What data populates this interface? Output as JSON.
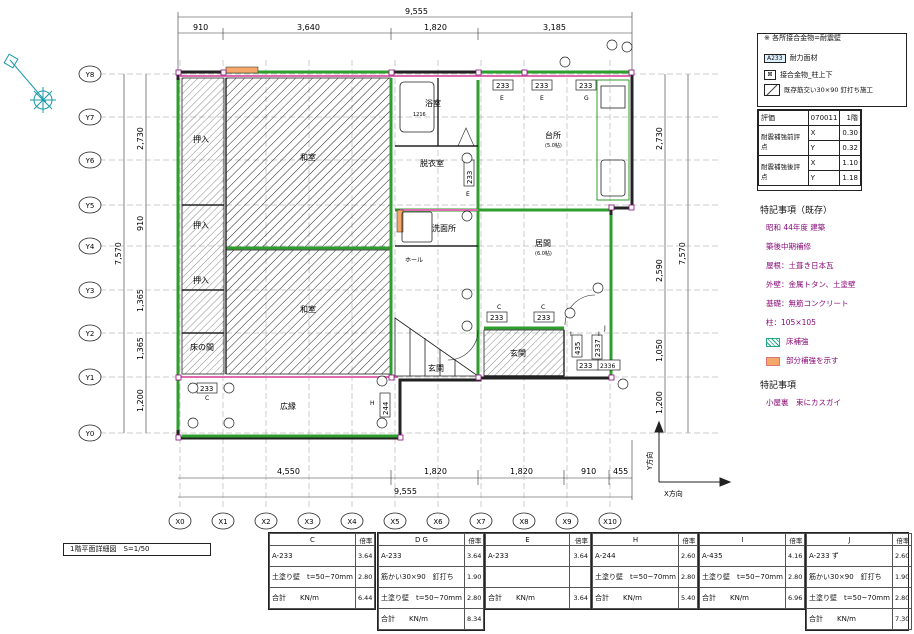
{
  "dims_top": [
    "9,555",
    "910",
    "3,640",
    "1,820",
    "3,185"
  ],
  "dims_bottom": [
    "4,550",
    "1,820",
    "1,820",
    "910",
    "455",
    "9,555"
  ],
  "dims_left": [
    "2,730",
    "910",
    "1,365",
    "1,365",
    "1,200",
    "7,570"
  ],
  "dims_right": [
    "2,730",
    "2,590",
    "1,050",
    "1,200",
    "7,570"
  ],
  "grid_y": [
    "Y8",
    "Y7",
    "Y6",
    "Y5",
    "Y4",
    "Y3",
    "Y2",
    "Y1",
    "Y0"
  ],
  "grid_x": [
    "X0",
    "X1",
    "X2",
    "X3",
    "X4",
    "X5",
    "X6",
    "X7",
    "X8",
    "X9",
    "X10"
  ],
  "rooms": {
    "bath": "浴室",
    "bath_note": "1216",
    "dressing": "脱衣室",
    "kitchen": "台所",
    "kitchen_sub": "(5.0帖)",
    "washroom": "洗面所",
    "living": "居間",
    "living_sub": "(6.0帖)",
    "washitsu1": "和室",
    "washitsu2": "和室",
    "oshiire1": "押入",
    "oshiire2": "押入",
    "oshiire3": "押入",
    "tokonoma": "床の間",
    "genkan": "玄関",
    "hiroen": "広縁",
    "entry": "玄関",
    "hall": "ホール"
  },
  "wall_codes": [
    "233",
    "233",
    "233",
    "233",
    "233",
    "233",
    "233",
    "233",
    "2336",
    "244",
    "435",
    "2337"
  ],
  "wall_letters": [
    "E",
    "E",
    "G",
    "E",
    "C",
    "C",
    "I",
    "I",
    "H",
    "J",
    "C"
  ],
  "legend": {
    "header": "※ 各所接合金物=耐震壁",
    "item1": "耐力面材",
    "item1_code": "A233",
    "item2": "接合金物_柱上下",
    "item3": "既存筋交い30×90 釘打ち施工"
  },
  "stats": {
    "r1_label": "評価",
    "r1_code": "070011",
    "r1_floor": "1階",
    "r2_label": "耐震補強前評点",
    "r2_x_axis": "X",
    "r2_x_val": "0.30",
    "r2_y_axis": "Y",
    "r2_y_val": "0.32",
    "r3_label": "耐震補強後評点",
    "r3_x_axis": "X",
    "r3_x_val": "1.10",
    "r3_y_axis": "Y",
    "r3_y_val": "1.18"
  },
  "notes": {
    "title": "特記事項（既存）",
    "items": [
      "昭和 44年度 建築",
      "築後中期補修",
      "屋根：土葺き日本瓦",
      "外壁：金属トタン、土塗壁",
      "基礎：無筋コンクリート",
      "柱：105×105",
      "床補強",
      "部分補強を示す"
    ],
    "title2": "特記事項",
    "item2": "小屋裏　束にカスガイ"
  },
  "axis_labels": {
    "x": "X方向",
    "y": "Y方向"
  },
  "scale_title": "1階平面詳細図　S=1/50",
  "tables": [
    {
      "label": "C",
      "rows": [
        [
          "A-233",
          "3.64"
        ],
        [
          "土塗り壁　t=50~70mm",
          "2.80"
        ],
        [
          "合計　　KN/m",
          "6.44"
        ]
      ]
    },
    {
      "label": "D G",
      "rows": [
        [
          "A-233",
          "3.64"
        ],
        [
          "筋かい30×90　釘打ち",
          "1.90"
        ],
        [
          "土塗り壁　t=50~70mm",
          "2.80"
        ],
        [
          "合計　　KN/m",
          "8.34"
        ]
      ]
    },
    {
      "label": "E",
      "rows": [
        [
          "A-233",
          "3.64"
        ],
        [
          "",
          ""
        ],
        [
          "合計　　KN/m",
          "3.64"
        ]
      ]
    },
    {
      "label": "H",
      "rows": [
        [
          "A-244",
          "2.60"
        ],
        [
          "土塗り壁　t=50~70mm",
          "2.80"
        ],
        [
          "合計　　KN/m",
          "5.40"
        ]
      ]
    },
    {
      "label": "I",
      "rows": [
        [
          "A-435",
          "4.16"
        ],
        [
          "土塗り壁　t=50~70mm",
          "2.80"
        ],
        [
          "合計　　KN/m",
          "6.96"
        ]
      ]
    },
    {
      "label": "J",
      "rows": [
        [
          "A-233 ず",
          "2.60"
        ],
        [
          "筋かい30×90　釘打ち",
          "1.90"
        ],
        [
          "土塗り壁　t=50~70mm",
          "2.80"
        ],
        [
          "合計　　KN/m",
          "7.30"
        ]
      ]
    }
  ],
  "col_head": "倍率"
}
